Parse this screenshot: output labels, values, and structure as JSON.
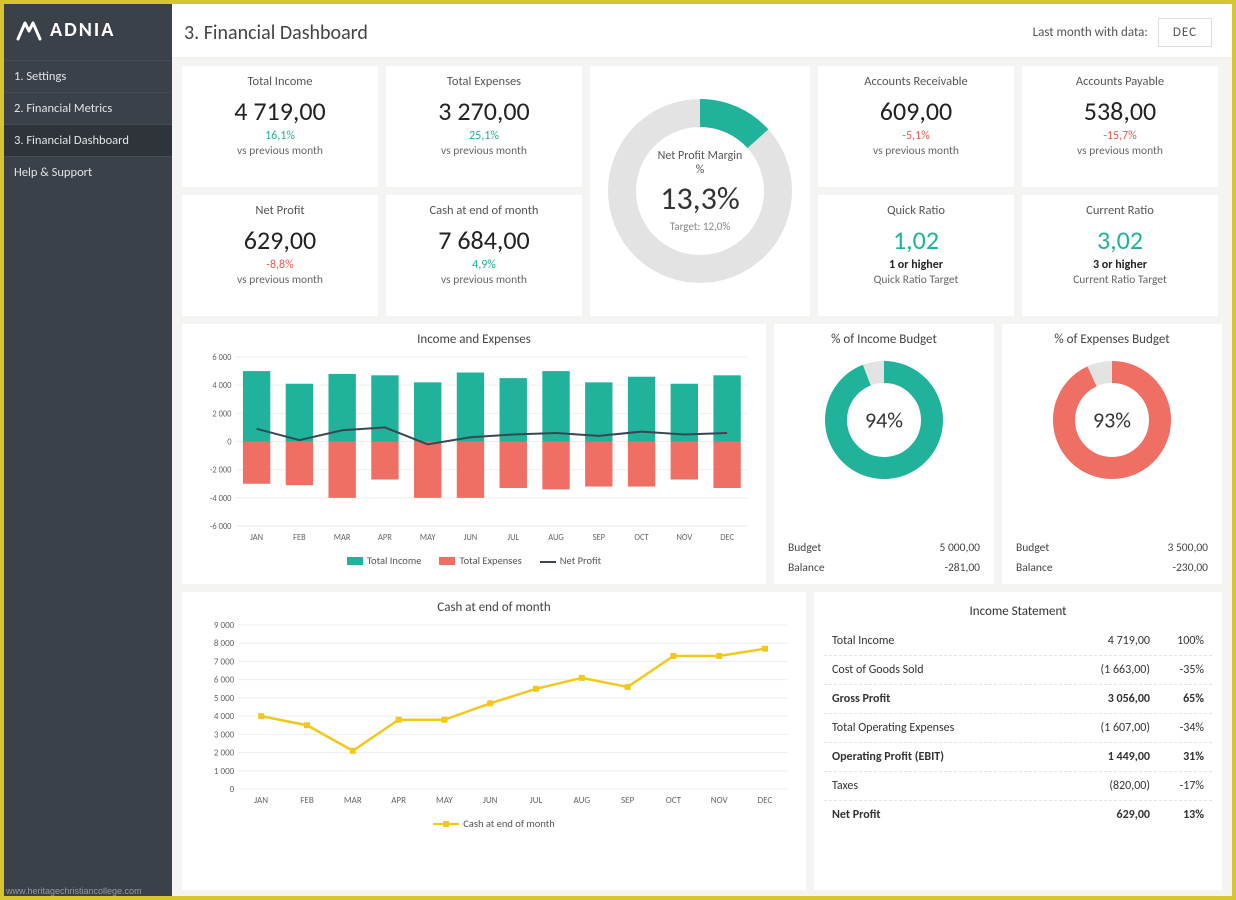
{
  "brand": "ADNIA",
  "nav": [
    {
      "label": "1. Settings"
    },
    {
      "label": "2. Financial Metrics"
    },
    {
      "label": "3. Financial Dashboard"
    },
    {
      "label": "Help & Support"
    }
  ],
  "nav_active": 2,
  "header": {
    "title": "3. Financial Dashboard",
    "last_month_label": "Last month with data:",
    "month": "DEC"
  },
  "kpi": {
    "total_income": {
      "label": "Total Income",
      "value": "4 719,00",
      "delta": "16,1%",
      "delta_dir": "up",
      "sub": "vs previous month"
    },
    "total_expenses": {
      "label": "Total Expenses",
      "value": "3 270,00",
      "delta": "25,1%",
      "delta_dir": "up",
      "sub": "vs previous month"
    },
    "accounts_receivable": {
      "label": "Accounts Receivable",
      "value": "609,00",
      "delta": "-5,1%",
      "delta_dir": "down",
      "sub": "vs previous month"
    },
    "accounts_payable": {
      "label": "Accounts Payable",
      "value": "538,00",
      "delta": "-15,7%",
      "delta_dir": "down",
      "sub": "vs previous month"
    },
    "net_profit": {
      "label": "Net Profit",
      "value": "629,00",
      "delta": "-8,8%",
      "delta_dir": "down",
      "sub": "vs previous month"
    },
    "cash_end": {
      "label": "Cash at end of month",
      "value": "7 684,00",
      "delta": "4,9%",
      "delta_dir": "up",
      "sub": "vs previous month"
    },
    "quick_ratio": {
      "label": "Quick Ratio",
      "value": "1,02",
      "target": "1 or higher",
      "target_sub": "Quick Ratio Target"
    },
    "current_ratio": {
      "label": "Current Ratio",
      "value": "3,02",
      "target": "3 or higher",
      "target_sub": "Current Ratio Target"
    }
  },
  "gauge": {
    "label": "Net Profit Margin %",
    "value": "13,3%",
    "target": "Target:  12,0%",
    "percent": 13.3
  },
  "income_expenses": {
    "title": "Income and Expenses",
    "legend": [
      "Total Income",
      "Total Expenses",
      "Net Profit"
    ]
  },
  "cash_chart": {
    "title": "Cash at end of month",
    "legend": "Cash at end of month"
  },
  "budget_income": {
    "title": "% of Income Budget",
    "value": "94%",
    "percent": 94,
    "budget_label": "Budget",
    "budget": "5 000,00",
    "balance_label": "Balance",
    "balance": "-281,00"
  },
  "budget_expenses": {
    "title": "% of Expenses Budget",
    "value": "93%",
    "percent": 93,
    "budget_label": "Budget",
    "budget": "3 500,00",
    "balance_label": "Balance",
    "balance": "-230,00"
  },
  "income_statement": {
    "title": "Income Statement",
    "rows": [
      {
        "l": "Total Income",
        "v": "4 719,00",
        "p": "100%",
        "bold": false
      },
      {
        "l": "Cost of Goods Sold",
        "v": "(1 663,00)",
        "p": "-35%",
        "bold": false
      },
      {
        "l": "Gross Profit",
        "v": "3 056,00",
        "p": "65%",
        "bold": true
      },
      {
        "l": "Total Operating Expenses",
        "v": "(1 607,00)",
        "p": "-34%",
        "bold": false
      },
      {
        "l": "Operating Profit (EBIT)",
        "v": "1 449,00",
        "p": "31%",
        "bold": true
      },
      {
        "l": "Taxes",
        "v": "(820,00)",
        "p": "-17%",
        "bold": false
      },
      {
        "l": "Net Profit",
        "v": "629,00",
        "p": "13%",
        "bold": true
      }
    ]
  },
  "watermark": "www.heritagechristiancollege.com",
  "chart_data": [
    {
      "type": "bar",
      "title": "Income and Expenses",
      "categories": [
        "JAN",
        "FEB",
        "MAR",
        "APR",
        "MAY",
        "JUN",
        "JUL",
        "AUG",
        "SEP",
        "OCT",
        "NOV",
        "DEC"
      ],
      "series": [
        {
          "name": "Total Income",
          "values": [
            5000,
            4100,
            4800,
            4700,
            4200,
            4900,
            4500,
            5000,
            4200,
            4600,
            4100,
            4700
          ]
        },
        {
          "name": "Total Expenses",
          "values": [
            -3000,
            -3100,
            -4000,
            -2700,
            -4000,
            -4000,
            -3300,
            -3400,
            -3200,
            -3200,
            -2700,
            -3300
          ]
        },
        {
          "name": "Net Profit",
          "kind": "line",
          "values": [
            900,
            100,
            800,
            1000,
            -200,
            300,
            500,
            600,
            400,
            700,
            500,
            600
          ]
        }
      ],
      "ylim": [
        -6000,
        6000
      ],
      "yticks": [
        -6000,
        -4000,
        -2000,
        0,
        2000,
        4000,
        6000
      ]
    },
    {
      "type": "line",
      "title": "Cash at end of month",
      "categories": [
        "JAN",
        "FEB",
        "MAR",
        "APR",
        "MAY",
        "JUN",
        "JUL",
        "AUG",
        "SEP",
        "OCT",
        "NOV",
        "DEC"
      ],
      "series": [
        {
          "name": "Cash at end of month",
          "values": [
            4000,
            3500,
            2100,
            3800,
            3800,
            4700,
            5500,
            6100,
            5600,
            7300,
            7300,
            7700
          ]
        }
      ],
      "ylim": [
        0,
        9000
      ],
      "yticks": [
        0,
        1000,
        2000,
        3000,
        4000,
        5000,
        6000,
        7000,
        8000,
        9000
      ]
    },
    {
      "type": "pie",
      "title": "Net Profit Margin %",
      "values": [
        13.3,
        86.7
      ],
      "labels": [
        "Net Profit Margin",
        "Remainder"
      ]
    },
    {
      "type": "pie",
      "title": "% of Income Budget",
      "values": [
        94,
        6
      ],
      "labels": [
        "Achieved",
        "Remaining"
      ]
    },
    {
      "type": "pie",
      "title": "% of Expenses Budget",
      "values": [
        93,
        7
      ],
      "labels": [
        "Achieved",
        "Remaining"
      ]
    }
  ]
}
